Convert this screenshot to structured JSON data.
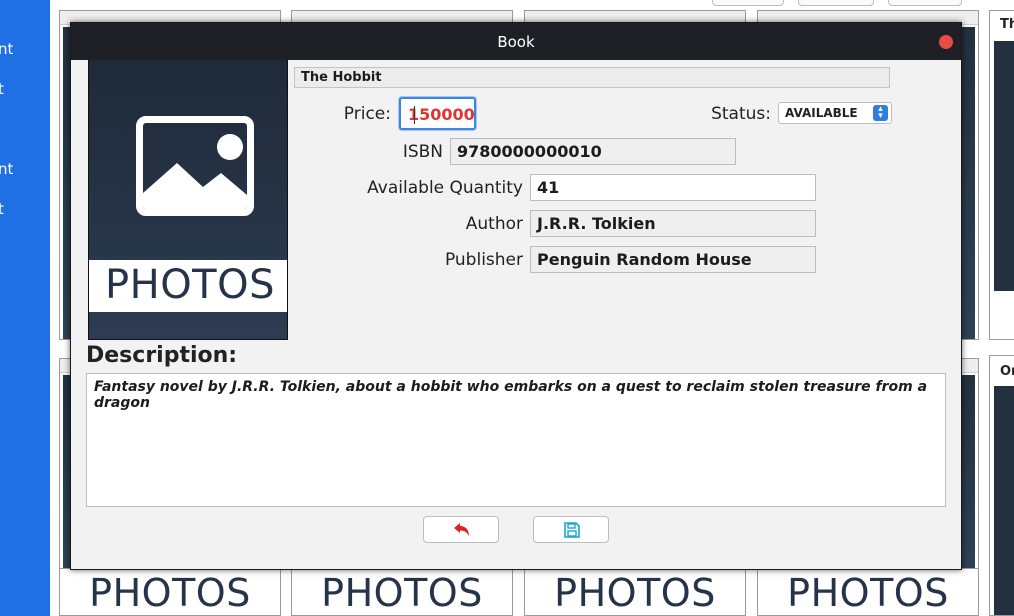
{
  "background": {
    "nav_items": [
      "nt",
      "t",
      "nt",
      "t"
    ],
    "right_titles": [
      "Th",
      "Or"
    ],
    "photos_label": "PHOTOS"
  },
  "dialog": {
    "title": "Book",
    "book_name": "The Hobbit",
    "price_label": "Price:",
    "price_value": "150000",
    "status_label": "Status:",
    "status_value": "AVAILABLE",
    "isbn_label": "ISBN",
    "isbn_value": "9780000000010",
    "quantity_label": "Available Quantity",
    "quantity_value": "41",
    "author_label": "Author",
    "author_value": "J.R.R. Tolkien",
    "publisher_label": "Publisher",
    "publisher_value": "Penguin Random House",
    "photo_label": "PHOTOS",
    "description_heading": "Description:",
    "description_text": "Fantasy novel by J.R.R. Tolkien, about a hobbit who embarks on a quest to reclaim stolen treasure from a dragon"
  },
  "icons": {
    "back": "undo-arrow-icon",
    "save": "floppy-disk-icon",
    "close": "close-icon",
    "photo": "image-placeholder-icon"
  },
  "colors": {
    "nav_blue": "#1f6fe5",
    "titlebar": "#1f2025",
    "close_red": "#e94a4a",
    "price_red": "#e03434",
    "save_teal": "#1ba8c9",
    "back_red": "#d92424"
  }
}
